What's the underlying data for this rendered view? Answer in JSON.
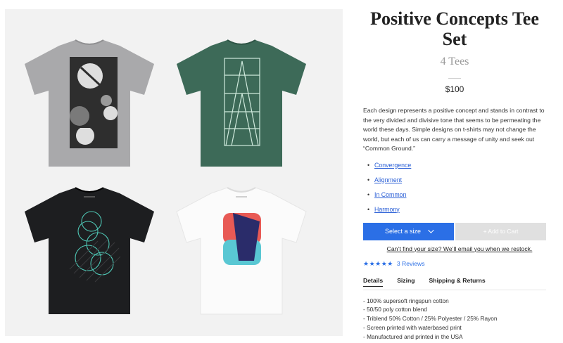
{
  "product": {
    "title": "Positive Concepts Tee Set",
    "subtitle": "4 Tees",
    "price": "$100",
    "description": "Each design represents a positive concept and stands in contrast to the very divided and divisive tone that seems to be permeating the world these days. Simple designs on t-shirts may not change the world, but each of us can carry a message of unity and seek out “Common Ground.”"
  },
  "designs": [
    {
      "label": "Convergence"
    },
    {
      "label": "Alignment"
    },
    {
      "label": "In Common"
    },
    {
      "label": "Harmony"
    }
  ],
  "bullet": "•",
  "actions": {
    "select_size": "Select a size",
    "add_to_cart": "+ Add to Cart",
    "restock_link": "Can’t find your size? We’ll email you when we restock."
  },
  "reviews": {
    "stars_display": "★★★★★",
    "rating": 4.5,
    "label": "3 Reviews"
  },
  "tabs": [
    {
      "label": "Details",
      "active": true
    },
    {
      "label": "Sizing",
      "active": false
    },
    {
      "label": "Shipping & Returns",
      "active": false
    }
  ],
  "details": [
    "- 100% supersoft ringspun cotton",
    "- 50/50 poly cotton blend",
    "- Triblend 50% Cotton / 25% Polyester / 25% Rayon",
    "- Screen printed with waterbased print",
    "- Manufactured and printed in the USA"
  ],
  "shirts": [
    {
      "name": "heather-grey",
      "color": "#a9a9ab"
    },
    {
      "name": "heather-green",
      "color": "#3d6a58"
    },
    {
      "name": "black",
      "color": "#1d1e20"
    },
    {
      "name": "white",
      "color": "#fbfbfb"
    }
  ],
  "colors": {
    "accent": "#2b6fe6",
    "link": "#2a5fd6",
    "disabled_button": "#e0e0e0"
  }
}
